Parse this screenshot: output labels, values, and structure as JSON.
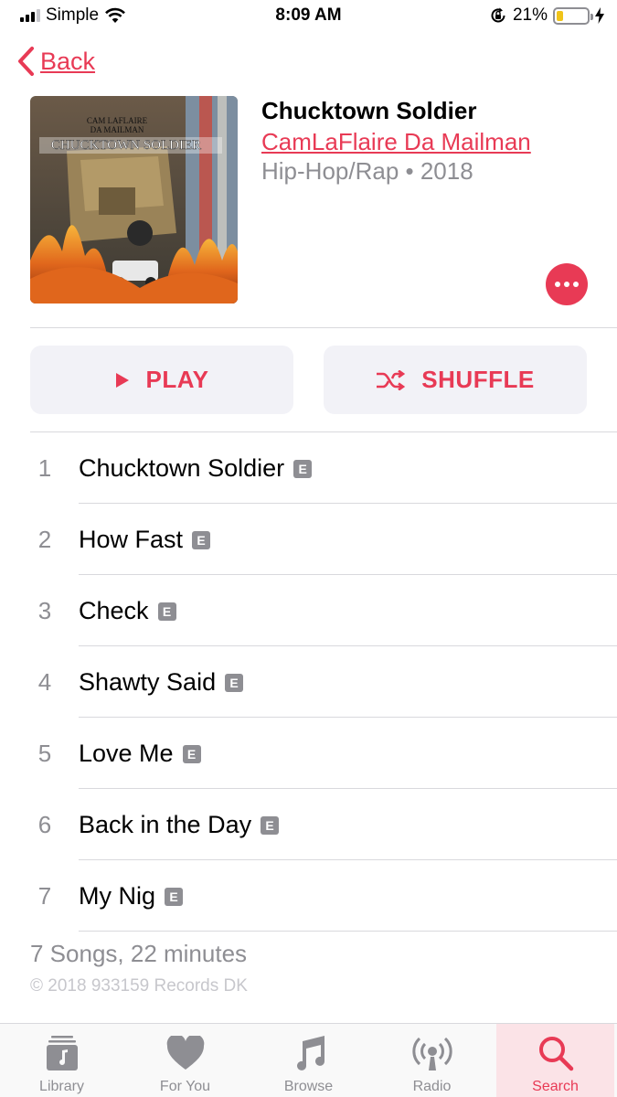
{
  "status_bar": {
    "carrier": "Simple",
    "time": "8:09 AM",
    "battery_percent": "21%",
    "battery_level": 0.21,
    "icons": [
      "signal-icon",
      "wifi-icon",
      "rotation-lock-icon",
      "battery-icon",
      "charging-icon"
    ]
  },
  "nav": {
    "back_label": "Back"
  },
  "album": {
    "title": "Chucktown Soldier",
    "artist": "CamLaFlaire Da Mailman",
    "meta": "Hip-Hop/Rap • 2018",
    "art_text_1": "CAM LAFLAIRE",
    "art_text_2": "DA MAILMAN",
    "art_text_3": "CHUCKTOWN SOLDIER"
  },
  "actions": {
    "play_label": "PLAY",
    "shuffle_label": "SHUFFLE"
  },
  "explicit_badge": "E",
  "tracks": [
    {
      "number": "1",
      "title": "Chucktown Soldier"
    },
    {
      "number": "2",
      "title": "How Fast"
    },
    {
      "number": "3",
      "title": "Check"
    },
    {
      "number": "4",
      "title": "Shawty Said"
    },
    {
      "number": "5",
      "title": "Love Me"
    },
    {
      "number": "6",
      "title": "Back in the Day"
    },
    {
      "number": "7",
      "title": "My Nig"
    }
  ],
  "summary": "7 Songs, 22 minutes",
  "copyright": "© 2018 933159 Records DK",
  "tab_bar": [
    {
      "label": "Library",
      "icon": "library-icon"
    },
    {
      "label": "For You",
      "icon": "heart-icon"
    },
    {
      "label": "Browse",
      "icon": "music-note-icon"
    },
    {
      "label": "Radio",
      "icon": "radio-icon"
    },
    {
      "label": "Search",
      "icon": "search-icon",
      "active": true
    }
  ],
  "colors": {
    "accent": "#e83a55",
    "secondary_text": "#8e8e93",
    "button_bg": "#f2f2f7",
    "battery": "#f0c419"
  }
}
